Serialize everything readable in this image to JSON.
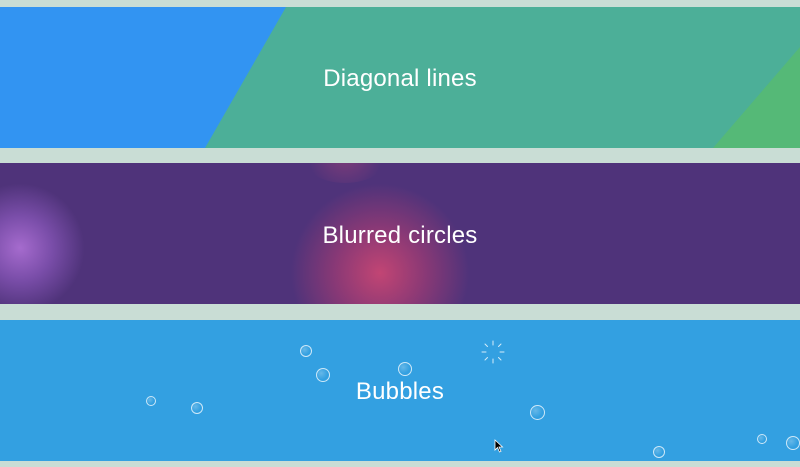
{
  "panels": {
    "diagonal": {
      "label": "Diagonal lines"
    },
    "blurred": {
      "label": "Blurred circles"
    },
    "bubbles": {
      "label": "Bubbles"
    }
  },
  "colors": {
    "background": "#c9ddd5",
    "diagonal_blue": "#3294f2",
    "diagonal_teal": "#4caf98",
    "diagonal_green": "#55b977",
    "blurred_base": "#4f337a",
    "blurred_pink": "#c0436f",
    "blurred_violet": "#9a62c2",
    "bubbles_base": "#33a0e1"
  }
}
